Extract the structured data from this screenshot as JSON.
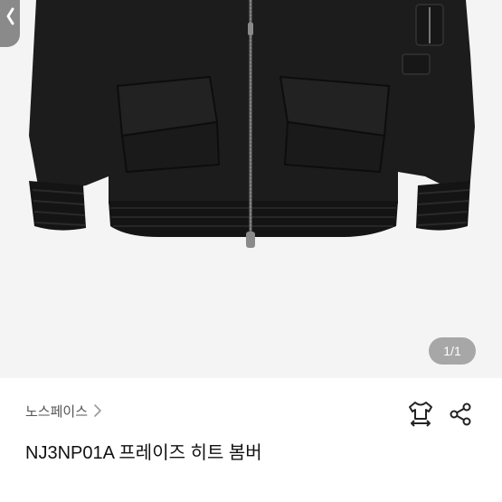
{
  "gallery": {
    "counter": "1/1",
    "back_icon": "chevron-left-icon"
  },
  "product": {
    "brand": "노스페이스",
    "brand_chevron_icon": "chevron-right-icon",
    "name": "NJ3NP01A 프레이즈 히트 봄버"
  },
  "actions": {
    "size_icon": "tshirt-size-icon",
    "share_icon": "share-icon"
  },
  "colors": {
    "photo_background": "#f4f4f4",
    "jacket": "#1c1c1c",
    "counter_badge": "#a7a7a7",
    "brand_text": "#555555",
    "title_text": "#111111"
  }
}
